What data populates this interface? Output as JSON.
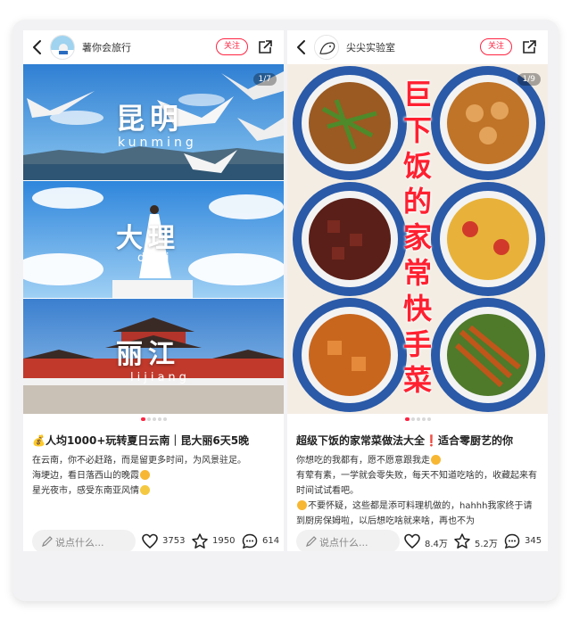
{
  "left_note": {
    "author": "薯你会旅行",
    "follow_label": "关注",
    "image_counter": "1/7",
    "image_text": {
      "city1": "昆明",
      "city1_pinyin": "kunming",
      "city2": "大理",
      "city2_pinyin": "dali",
      "city3": "丽江",
      "city3_pinyin": "lijiang"
    },
    "title": "💰人均1000+玩转夏日云南｜昆大丽6天5晚",
    "body": [
      "在云南，你不必赶路，而是留更多时间，为风景驻足。",
      "海埂边，看日落西山的晚霞",
      "星光夜市，感受东南亚风情"
    ],
    "comment_placeholder": "说点什么...",
    "likes": "3753",
    "collects": "1950",
    "comments": "614"
  },
  "right_note": {
    "author": "尖尖实验室",
    "follow_label": "关注",
    "image_counter": "1/9",
    "image_text_chars": [
      "巨",
      "下",
      "饭",
      "的",
      "家",
      "常",
      "快",
      "手",
      "菜"
    ],
    "title": "超级下饭的家常菜做法大全❗适合零厨艺的你",
    "body": [
      "你想吃的我都有，愿不愿意跟我走",
      "有荤有素，一学就会零失败，每天不知道吃啥的，收藏起来有时间试试看吧。",
      "不要怀疑，这些都是添可料理机做的，hahhh我家终于请到厨房保姆啦，以后想吃啥就来啥，再也不为"
    ],
    "comment_placeholder": "说点什么...",
    "likes": "8.4万",
    "collects": "5.2万",
    "comments": "345"
  },
  "colors": {
    "accent": "#ff2442",
    "text": "#222222",
    "sky": "#3d8fd8"
  },
  "icons": [
    "back-arrow-icon",
    "share-icon",
    "heart-icon",
    "star-icon",
    "comment-icon",
    "pen-icon"
  ]
}
